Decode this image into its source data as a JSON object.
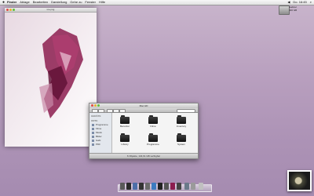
{
  "menubar": {
    "apple": "",
    "items": [
      "Finder",
      "Ablage",
      "Bearbeiten",
      "Darstellung",
      "Gehe zu",
      "Fenster",
      "Hilfe"
    ],
    "clock": "Do. 16:45"
  },
  "preview": {
    "title": "ice.png"
  },
  "desktop_icon": {
    "label_line1": "Gabriel",
    "label_line2": "320 GB"
  },
  "finder": {
    "title": "Mac HD",
    "sidebar_header_devices": "GERÄTE",
    "sidebar_header_places": "ORTE",
    "sidebar_items": [
      "Programme",
      "Filme",
      "Musik",
      "Bilder",
      "Gabi",
      "PDF"
    ],
    "folders": [
      "Benutzer",
      "Filme",
      "Inventory",
      "Library",
      "Programme",
      "System"
    ],
    "status": "6 Objekte, 134,61 GB verfügbar"
  },
  "colors": {
    "accent": "#9a1d52",
    "desktop": "#b89fbe"
  }
}
